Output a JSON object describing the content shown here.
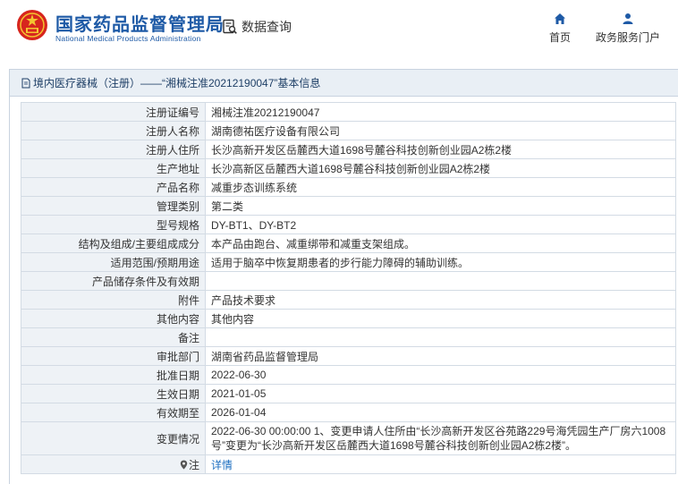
{
  "header": {
    "site_title": "国家药品监督管理局",
    "site_subtitle": "National Medical Products Administration",
    "query_label": "数据查询",
    "nav": [
      {
        "label": "首页",
        "icon": "home-icon"
      },
      {
        "label": "政务服务门户",
        "icon": "user-icon"
      }
    ]
  },
  "panel": {
    "breadcrumb": "境内医疗器械（注册）——“湘械注准20212190047”基本信息",
    "rows": [
      {
        "key": "注册证编号",
        "value": "湘械注准20212190047"
      },
      {
        "key": "注册人名称",
        "value": "湖南德祐医疗设备有限公司"
      },
      {
        "key": "注册人住所",
        "value": "长沙高新开发区岳麓西大道1698号麓谷科技创新创业园A2栋2楼"
      },
      {
        "key": "生产地址",
        "value": "长沙高新区岳麓西大道1698号麓谷科技创新创业园A2栋2楼"
      },
      {
        "key": "产品名称",
        "value": "减重步态训练系统"
      },
      {
        "key": "管理类别",
        "value": "第二类"
      },
      {
        "key": "型号规格",
        "value": "DY-BT1、DY-BT2"
      },
      {
        "key": "结构及组成/主要组成成分",
        "value": "本产品由跑台、减重绑带和减重支架组成。"
      },
      {
        "key": "适用范围/预期用途",
        "value": "适用于脑卒中恢复期患者的步行能力障碍的辅助训练。"
      },
      {
        "key": "产品储存条件及有效期",
        "value": ""
      },
      {
        "key": "附件",
        "value": "产品技术要求"
      },
      {
        "key": "其他内容",
        "value": "其他内容"
      },
      {
        "key": "备注",
        "value": ""
      },
      {
        "key": "审批部门",
        "value": "湖南省药品监督管理局"
      },
      {
        "key": "批准日期",
        "value": "2022-06-30"
      },
      {
        "key": "生效日期",
        "value": "2021-01-05"
      },
      {
        "key": "有效期至",
        "value": "2026-01-04"
      },
      {
        "key": "变更情况",
        "value": "2022-06-30 00:00:00 1、变更申请人住所由“长沙高新开发区谷苑路229号海凭园生产厂房六1008号”变更为“长沙高新开发区岳麓西大道1698号麓谷科技创新创业园A2栋2楼”。"
      }
    ],
    "note_row": {
      "key": "注",
      "value": "详情"
    }
  },
  "colors": {
    "brand_blue": "#1e5aa6",
    "header_bg": "#e9eff5",
    "key_cell_bg": "#eef2f6",
    "link": "#1e6fc1"
  }
}
